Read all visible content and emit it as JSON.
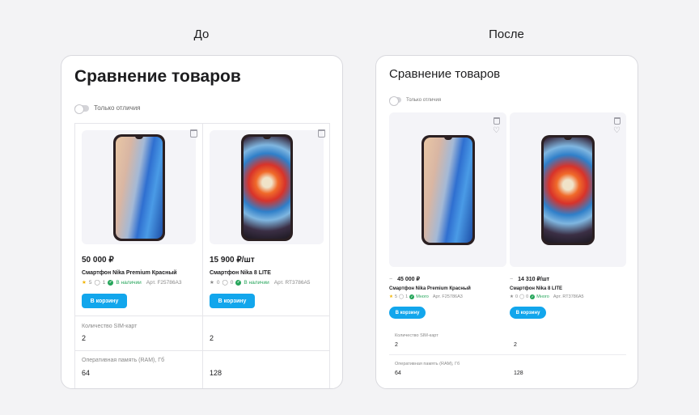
{
  "labels": {
    "before": "До",
    "after": "После"
  },
  "before": {
    "title": "Сравнение товаров",
    "toggle_label": "Только отличия",
    "products": [
      {
        "price": "50 000 ₽",
        "name": "Смартфон Nika Premium Красный",
        "rating": "5",
        "reviews": "1",
        "stock": "В наличии",
        "article": "Арт. F25786A3",
        "cart": "В корзину"
      },
      {
        "price": "15 900 ₽/шт",
        "name": "Смартфон Nika 8 LITE",
        "rating": "0",
        "reviews": "0",
        "stock": "В наличии",
        "article": "Арт. RT3786A5",
        "cart": "В корзину"
      }
    ],
    "specs": [
      {
        "label": "Количество SIM-карт",
        "values": [
          "2",
          "2"
        ]
      },
      {
        "label": "Оперативная память (RAM), Гб",
        "values": [
          "64",
          "128"
        ]
      }
    ]
  },
  "after": {
    "title": "Сравнение товаров",
    "toggle_label": "Только отличия",
    "products": [
      {
        "price": "45 000 ₽",
        "name": "Смартфон Nika Premium Красный",
        "rating": "5",
        "reviews": "1",
        "stock": "Много",
        "article": "Арт. F25786A3",
        "cart": "В корзину"
      },
      {
        "price": "14 310 ₽/шт",
        "name": "Смартфон Nika 8 LITE",
        "rating": "0",
        "reviews": "0",
        "stock": "Много",
        "article": "Арт. RT3786A5",
        "cart": "В корзину"
      }
    ],
    "specs": [
      {
        "label": "Количество SIM-карт",
        "values": [
          "2",
          "2"
        ]
      },
      {
        "label": "Оперативная память (RAM), Гб",
        "values": [
          "64",
          "128"
        ]
      }
    ]
  },
  "colors": {
    "accent": "#12a6ec",
    "in_stock": "#25a55a",
    "star": "#f2b300"
  },
  "icons": {
    "delete": "trash-icon",
    "favorite": "heart-icon",
    "rating": "star-icon",
    "reviews": "comment-icon",
    "availability": "check-circle-icon"
  }
}
